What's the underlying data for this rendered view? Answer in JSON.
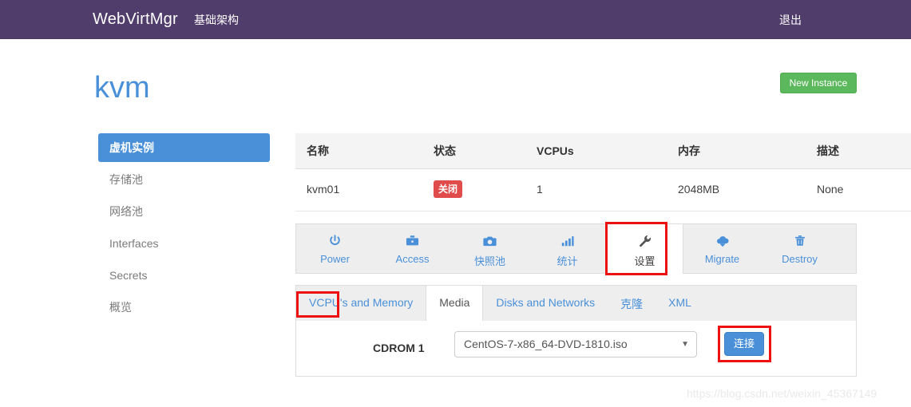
{
  "navbar": {
    "brand": "WebVirtMgr",
    "infrastructure_label": "基础架构",
    "logout_label": "退出",
    "background": "#513d6b"
  },
  "header": {
    "page_title": "kvm",
    "new_instance_label": "New Instance",
    "new_instance_color": "#5cb85c"
  },
  "sidebar": {
    "items": [
      {
        "label": "虚机实例",
        "active": true
      },
      {
        "label": "存储池",
        "active": false
      },
      {
        "label": "网络池",
        "active": false
      },
      {
        "label": "Interfaces",
        "active": false
      },
      {
        "label": "Secrets",
        "active": false
      },
      {
        "label": "概览",
        "active": false
      }
    ],
    "active_color": "#4a90d9"
  },
  "instances_table": {
    "columns": [
      "名称",
      "状态",
      "VCPUs",
      "内存",
      "描述"
    ],
    "rows": [
      {
        "name": "kvm01",
        "state": "关闭",
        "state_color": "#e04b4b",
        "vcpus": "1",
        "memory": "2048MB",
        "description": "None"
      }
    ]
  },
  "action_toolbar": {
    "tabs": [
      {
        "label": "Power",
        "icon": "power-icon",
        "active": false
      },
      {
        "label": "Access",
        "icon": "briefcase-icon",
        "active": false
      },
      {
        "label": "快照池",
        "icon": "camera-icon",
        "active": false
      },
      {
        "label": "统计",
        "icon": "chart-bar-icon",
        "active": false
      },
      {
        "label": "设置",
        "icon": "wrench-icon",
        "active": true
      },
      {
        "label": "Migrate",
        "icon": "cloud-download-icon",
        "active": false
      },
      {
        "label": "Destroy",
        "icon": "trash-icon",
        "active": false
      }
    ]
  },
  "sub_tabs": {
    "tabs": [
      {
        "label": "VCPU's and Memory",
        "active": false
      },
      {
        "label": "Media",
        "active": true
      },
      {
        "label": "Disks and Networks",
        "active": false
      },
      {
        "label": "克隆",
        "active": false
      },
      {
        "label": "XML",
        "active": false
      }
    ]
  },
  "media_panel": {
    "cdrom_label": "CDROM 1",
    "selected_iso": "CentOS-7-x86_64-DVD-1810.iso",
    "caret": "▼",
    "connect_label": "连接",
    "connect_color": "#4a90d9"
  },
  "annotations": {
    "highlight_color": "#ee1111",
    "targets": [
      "设置",
      "Media",
      "连接"
    ]
  },
  "watermark": {
    "text": "https://blog.csdn.net/weixin_45367149"
  }
}
